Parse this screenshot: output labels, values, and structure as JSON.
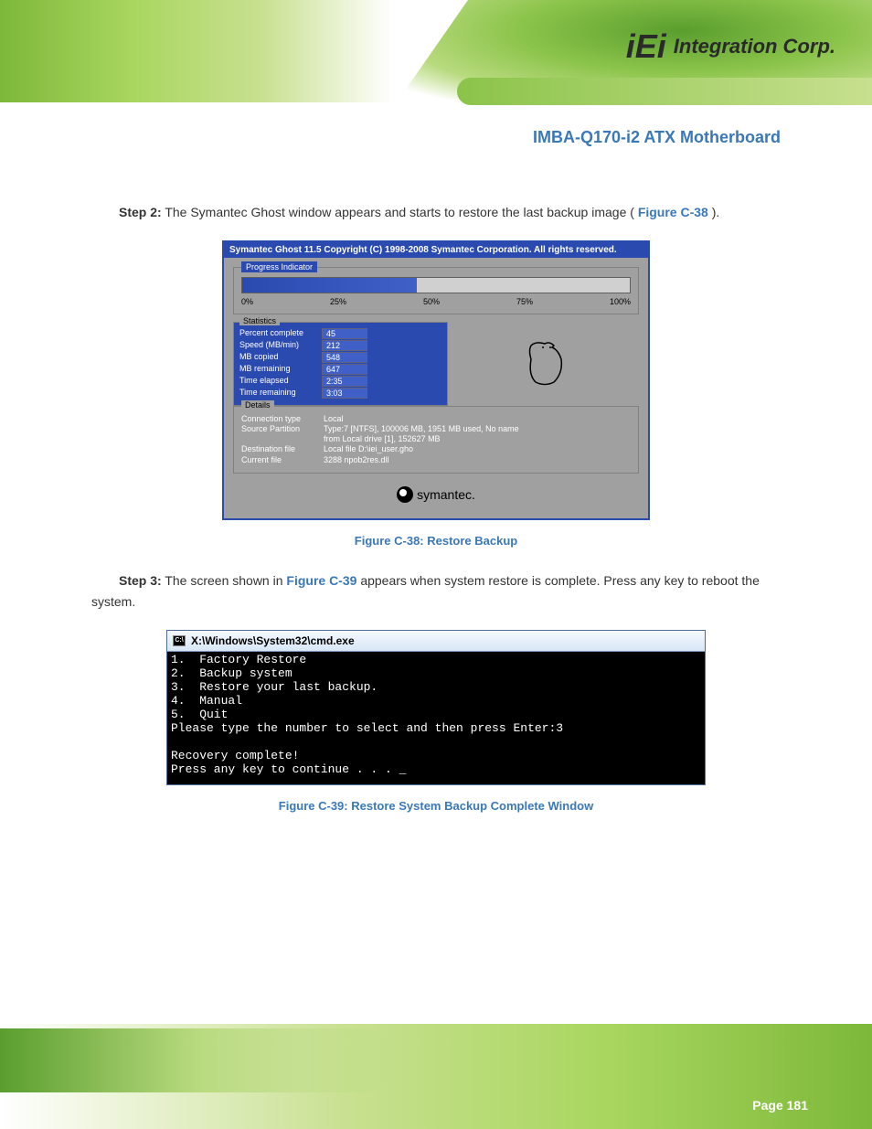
{
  "header": {
    "logo_main": "iEi",
    "logo_sub": "Integration Corp."
  },
  "product_title": "IMBA-Q170-i2 ATX Motherboard",
  "steps": {
    "s2": {
      "num": "Step 2:",
      "text_a": "The Symantec Ghost window appears and starts to restore the last backup image (",
      "figref": "Figure C-38",
      "text_b": ")."
    },
    "s3": {
      "num": "Step 3:",
      "text_a": "The screen shown in ",
      "figref": "Figure C-39",
      "text_b": " appears when system restore is complete. Press any key to reboot the system."
    }
  },
  "figcap1": "Figure C-38: Restore Backup",
  "figcap2": "Figure C-39: Restore System Backup Complete Window",
  "ghost": {
    "title": "Symantec Ghost 11.5   Copyright (C) 1998-2008 Symantec Corporation. All rights reserved.",
    "progress_label": "Progress Indicator",
    "ticks": [
      "0%",
      "25%",
      "50%",
      "75%",
      "100%"
    ],
    "stats_label": "Statistics",
    "stats": [
      {
        "k": "Percent complete",
        "v": "45"
      },
      {
        "k": "Speed (MB/min)",
        "v": "212"
      },
      {
        "k": "MB copied",
        "v": "548"
      },
      {
        "k": "MB remaining",
        "v": "647"
      },
      {
        "k": "Time elapsed",
        "v": "2:35"
      },
      {
        "k": "Time remaining",
        "v": "3:03"
      }
    ],
    "details_label": "Details",
    "details": [
      {
        "k": "Connection type",
        "v": "Local"
      },
      {
        "k": "Source Partition",
        "v": "Type:7 [NTFS], 100006 MB, 1951 MB used, No name"
      },
      {
        "k": "",
        "v": "from Local drive [1], 152627 MB"
      },
      {
        "k": "Destination file",
        "v": "Local file D:\\iei_user.gho"
      },
      {
        "k": "",
        "v": ""
      },
      {
        "k": "Current file",
        "v": "3288 npob2res.dll"
      }
    ],
    "symantec": "symantec."
  },
  "cmd": {
    "title": "X:\\Windows\\System32\\cmd.exe",
    "lines": [
      "1.  Factory Restore",
      "2.  Backup system",
      "3.  Restore your last backup.",
      "4.  Manual",
      "5.  Quit",
      "Please type the number to select and then press Enter:3",
      "",
      "Recovery complete!",
      "Press any key to continue . . . _"
    ]
  },
  "footer": {
    "page": "Page 181"
  }
}
